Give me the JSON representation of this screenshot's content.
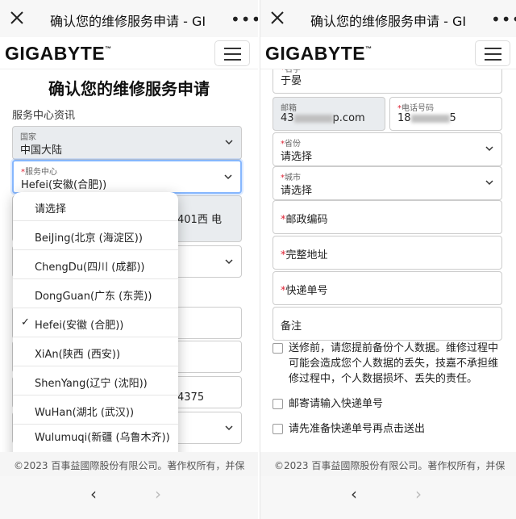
{
  "window": {
    "title": "确认您的维修服务申请 - GI",
    "more": "•••"
  },
  "brand": {
    "logo": "GIGABYTE",
    "tm": "™"
  },
  "nav": {
    "back": "‹",
    "forward": "›"
  },
  "form": {
    "heading": "确认您的维修服务申请",
    "section_service": "服务中心资讯",
    "country": {
      "label": "国家",
      "value": "中国大陆"
    },
    "service_center": {
      "label": "服务中心",
      "value": "Hefei(安徽(合肥))"
    },
    "behind_text_1": "401西 电",
    "behind_text_2": "4375",
    "name": {
      "label": "名字",
      "value": "于晏"
    },
    "email": {
      "label": "邮箱",
      "value_start": "43",
      "value_end": "p.com"
    },
    "phone": {
      "label": "电话号码",
      "value_start": "18",
      "value_end": "5"
    },
    "province": {
      "label": "省份",
      "value": "请选择"
    },
    "city": {
      "label": "城市",
      "value": "请选择"
    },
    "postal_code": {
      "label": "邮政编码"
    },
    "full_address": {
      "label": "完整地址"
    },
    "tracking_number": {
      "label": "快递单号"
    },
    "remarks": {
      "label": "备注"
    },
    "checkboxes": [
      "送修前，请您提前备份个人数据。维修过程中可能会造成您个人数据的丢失，技嘉不承担维修过程中，个人数据损坏、丢失的责任。",
      "邮寄请输入快递单号",
      "请先准备快递单号再点击送出"
    ]
  },
  "dropdown": {
    "options": [
      "请选择",
      "BeiJing(北京 (海淀区))",
      "ChengDu(四川 (成都))",
      "DongGuan(广东 (东莞))",
      "Hefei(安徽 (合肥))",
      "XiAn(陕西 (西安))",
      "ShenYang(辽宁 (沈阳))",
      "WuHan(湖北 (武汉))",
      "Wulumuqi(新疆 (乌鲁木齐))"
    ],
    "check": "✓"
  },
  "footer": {
    "left": "©2023 百事益國際股份有限公司。著作权所有，并保",
    "right": "©2023 百事益國際股份有限公司。著作权所有，并保"
  }
}
